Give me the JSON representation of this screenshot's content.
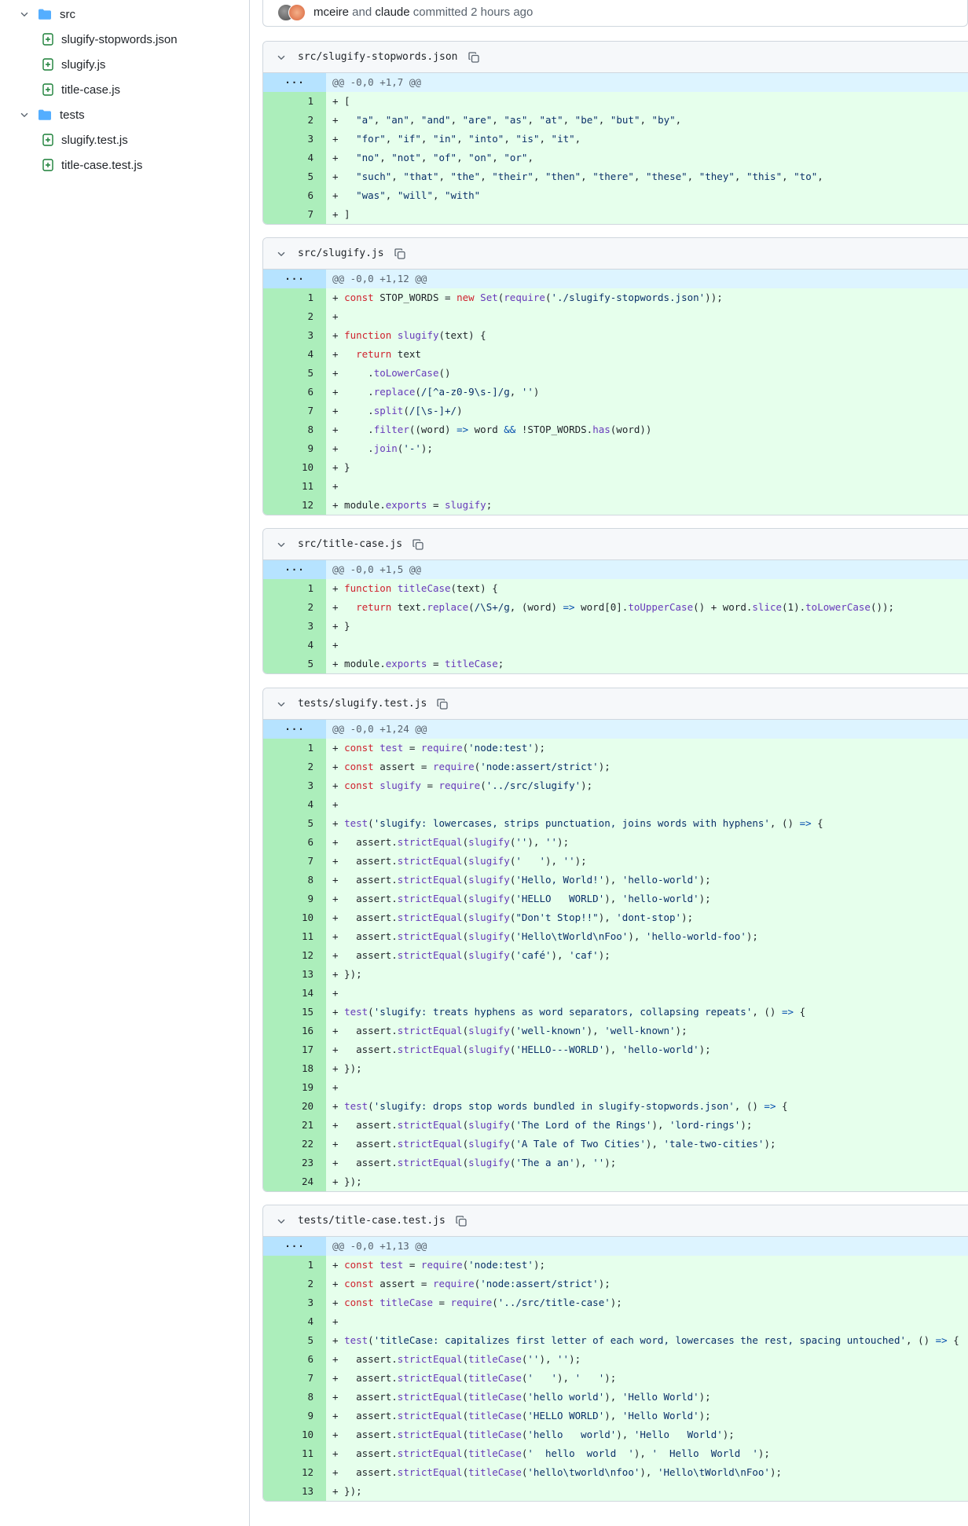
{
  "sidebar": {
    "tree": [
      {
        "type": "folder",
        "label": "src",
        "depth": 0
      },
      {
        "type": "file",
        "label": "slugify-stopwords.json",
        "depth": 1
      },
      {
        "type": "file",
        "label": "slugify.js",
        "depth": 1
      },
      {
        "type": "file",
        "label": "title-case.js",
        "depth": 1
      },
      {
        "type": "folder",
        "label": "tests",
        "depth": 0
      },
      {
        "type": "file",
        "label": "slugify.test.js",
        "depth": 1
      },
      {
        "type": "file",
        "label": "title-case.test.js",
        "depth": 1
      }
    ]
  },
  "commit": {
    "author1": "mceire",
    "and_text": " and ",
    "author2": "claude",
    "suffix": " committed 2 hours ago"
  },
  "colors": {
    "added_line_bg": "#e6ffec",
    "added_num_bg": "#aceebb",
    "hunk_bg": "#ddf4ff",
    "hunk_num_bg": "#b6e3ff",
    "keyword": "#cf222e",
    "function": "#6639ba",
    "string": "#0a3069"
  },
  "files": [
    {
      "path": "src/slugify-stopwords.json",
      "hunk": "@@ -0,0 +1,7 @@",
      "lines": [
        "+ [",
        "+   \"a\", \"an\", \"and\", \"are\", \"as\", \"at\", \"be\", \"but\", \"by\",",
        "+   \"for\", \"if\", \"in\", \"into\", \"is\", \"it\",",
        "+   \"no\", \"not\", \"of\", \"on\", \"or\",",
        "+   \"such\", \"that\", \"the\", \"their\", \"then\", \"there\", \"these\", \"they\", \"this\", \"to\",",
        "+   \"was\", \"will\", \"with\"",
        "+ ]"
      ]
    },
    {
      "path": "src/slugify.js",
      "hunk": "@@ -0,0 +1,12 @@",
      "lines": [
        "+ const STOP_WORDS = new Set(require('./slugify-stopwords.json'));",
        "+",
        "+ function slugify(text) {",
        "+   return text",
        "+     .toLowerCase()",
        "+     .replace(/[^a-z0-9\\s-]/g, '')",
        "+     .split(/[\\s-]+/)",
        "+     .filter((word) => word && !STOP_WORDS.has(word))",
        "+     .join('-');",
        "+ }",
        "+",
        "+ module.exports = slugify;"
      ]
    },
    {
      "path": "src/title-case.js",
      "hunk": "@@ -0,0 +1,5 @@",
      "lines": [
        "+ function titleCase(text) {",
        "+   return text.replace(/\\S+/g, (word) => word[0].toUpperCase() + word.slice(1).toLowerCase());",
        "+ }",
        "+",
        "+ module.exports = titleCase;"
      ]
    },
    {
      "path": "tests/slugify.test.js",
      "hunk": "@@ -0,0 +1,24 @@",
      "lines": [
        "+ const test = require('node:test');",
        "+ const assert = require('node:assert/strict');",
        "+ const slugify = require('../src/slugify');",
        "+",
        "+ test('slugify: lowercases, strips punctuation, joins words with hyphens', () => {",
        "+   assert.strictEqual(slugify(''), '');",
        "+   assert.strictEqual(slugify('   '), '');",
        "+   assert.strictEqual(slugify('Hello, World!'), 'hello-world');",
        "+   assert.strictEqual(slugify('HELLO   WORLD'), 'hello-world');",
        "+   assert.strictEqual(slugify(\"Don't Stop!!\"), 'dont-stop');",
        "+   assert.strictEqual(slugify('Hello\\tWorld\\nFoo'), 'hello-world-foo');",
        "+   assert.strictEqual(slugify('café'), 'caf');",
        "+ });",
        "+",
        "+ test('slugify: treats hyphens as word separators, collapsing repeats', () => {",
        "+   assert.strictEqual(slugify('well-known'), 'well-known');",
        "+   assert.strictEqual(slugify('HELLO---WORLD'), 'hello-world');",
        "+ });",
        "+",
        "+ test('slugify: drops stop words bundled in slugify-stopwords.json', () => {",
        "+   assert.strictEqual(slugify('The Lord of the Rings'), 'lord-rings');",
        "+   assert.strictEqual(slugify('A Tale of Two Cities'), 'tale-two-cities');",
        "+   assert.strictEqual(slugify('The a an'), '');",
        "+ });"
      ]
    },
    {
      "path": "tests/title-case.test.js",
      "hunk": "@@ -0,0 +1,13 @@",
      "lines": [
        "+ const test = require('node:test');",
        "+ const assert = require('node:assert/strict');",
        "+ const titleCase = require('../src/title-case');",
        "+",
        "+ test('titleCase: capitalizes first letter of each word, lowercases the rest, spacing untouched', () => {",
        "+   assert.strictEqual(titleCase(''), '');",
        "+   assert.strictEqual(titleCase('   '), '   ');",
        "+   assert.strictEqual(titleCase('hello world'), 'Hello World');",
        "+   assert.strictEqual(titleCase('HELLO WORLD'), 'Hello World');",
        "+   assert.strictEqual(titleCase('hello   world'), 'Hello   World');",
        "+   assert.strictEqual(titleCase('  hello  world  '), '  Hello  World  ');",
        "+   assert.strictEqual(titleCase('hello\\tworld\\nfoo'), 'Hello\\tWorld\\nFoo');",
        "+ });"
      ]
    }
  ]
}
